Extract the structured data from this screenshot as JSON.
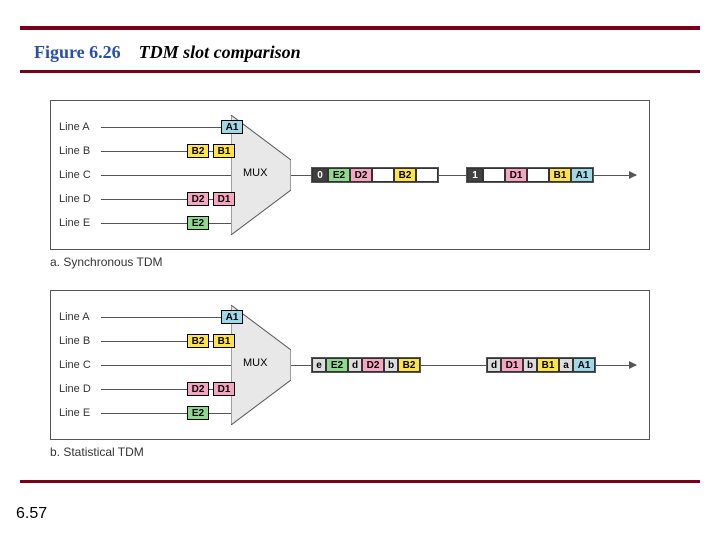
{
  "title": {
    "fig_num": "Figure 6.26",
    "caption": "TDM slot comparison"
  },
  "page_num": "6.57",
  "lines": {
    "a": "Line A",
    "b": "Line B",
    "c": "Line C",
    "d": "Line D",
    "e": "Line E"
  },
  "mux_label": "MUX",
  "panel_a": {
    "caption": "a. Synchronous TDM",
    "inputs": {
      "A": [
        "A1"
      ],
      "B": [
        "B2",
        "B1"
      ],
      "D": [
        "D2",
        "D1"
      ],
      "E": [
        "E2"
      ]
    },
    "frame1": {
      "hdr": "0",
      "cells": [
        "E2",
        "D2",
        "",
        "B2",
        ""
      ]
    },
    "frame2": {
      "hdr": "1",
      "cells": [
        "",
        "D1",
        "",
        "B1",
        "A1"
      ]
    }
  },
  "panel_b": {
    "caption": "b. Statistical TDM",
    "inputs": {
      "A": [
        "A1"
      ],
      "B": [
        "B2",
        "B1"
      ],
      "D": [
        "D2",
        "D1"
      ],
      "E": [
        "E2"
      ]
    },
    "frame1": {
      "pairs": [
        [
          "e",
          "E2"
        ],
        [
          "d",
          "D2"
        ],
        [
          "b",
          "B2"
        ]
      ]
    },
    "frame2": {
      "pairs": [
        [
          "d",
          "D1"
        ],
        [
          "b",
          "B1"
        ],
        [
          "a",
          "A1"
        ]
      ]
    }
  }
}
